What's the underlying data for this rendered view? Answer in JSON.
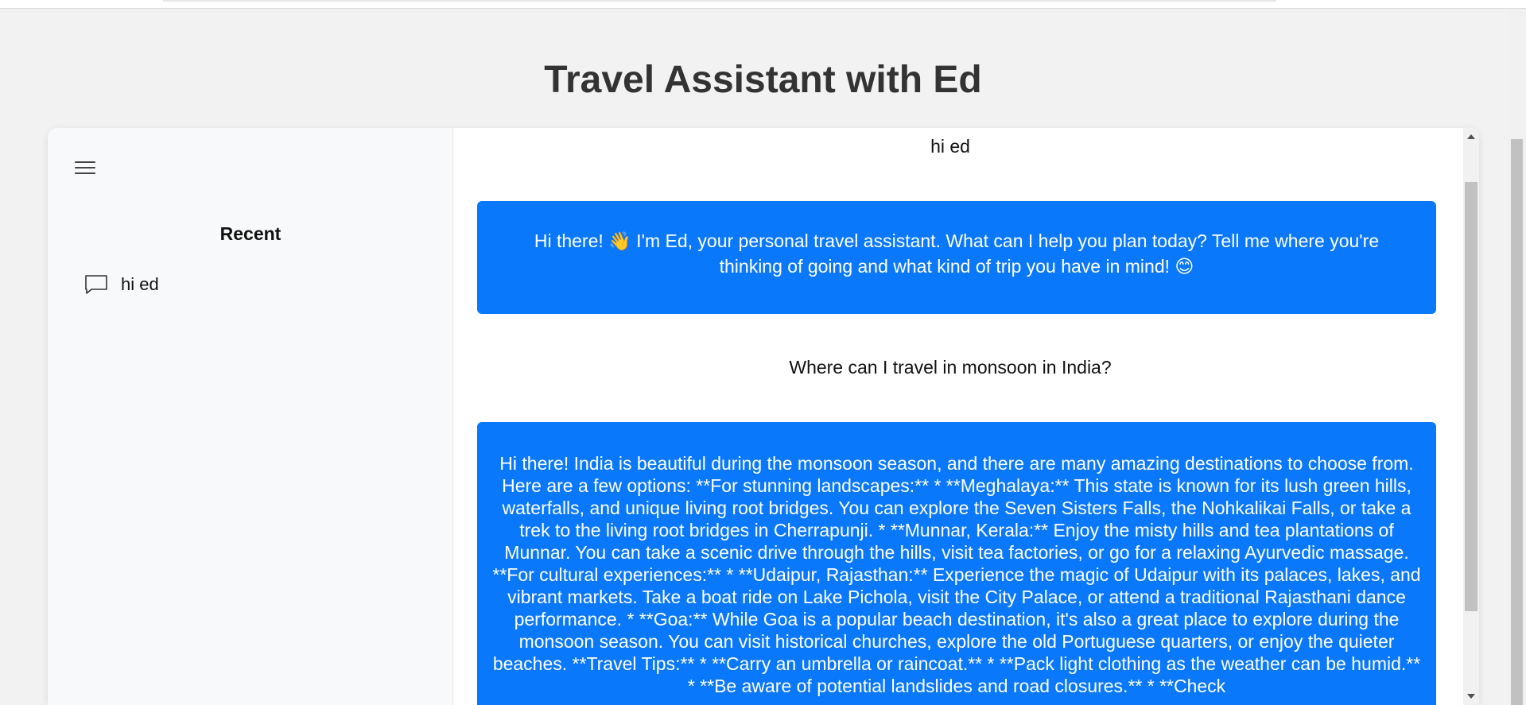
{
  "header": {
    "title": "Travel Assistant with Ed"
  },
  "sidebar": {
    "menu_icon": "hamburger-menu-icon",
    "recent_heading": "Recent",
    "recent_items": [
      {
        "icon": "chat-bubble-icon",
        "label": "hi ed"
      }
    ]
  },
  "chat": {
    "messages": [
      {
        "role": "user",
        "text": "hi ed"
      },
      {
        "role": "assistant",
        "text": "Hi there! 👋 I'm Ed, your personal travel assistant. What can I help you plan today? Tell me where you're thinking of going and what kind of trip you have in mind! 😊"
      },
      {
        "role": "user",
        "text": "Where can I travel in monsoon in India?"
      },
      {
        "role": "assistant",
        "text": "Hi there! India is beautiful during the monsoon season, and there are many amazing destinations to choose from. Here are a few options: **For stunning landscapes:** * **Meghalaya:** This state is known for its lush green hills, waterfalls, and unique living root bridges. You can explore the Seven Sisters Falls, the Nohkalikai Falls, or take a trek to the living root bridges in Cherrapunji. * **Munnar, Kerala:** Enjoy the misty hills and tea plantations of Munnar. You can take a scenic drive through the hills, visit tea factories, or go for a relaxing Ayurvedic massage. **For cultural experiences:** * **Udaipur, Rajasthan:** Experience the magic of Udaipur with its palaces, lakes, and vibrant markets. Take a boat ride on Lake Pichola, visit the City Palace, or attend a traditional Rajasthani dance performance. * **Goa:** While Goa is a popular beach destination, it's also a great place to explore during the monsoon season. You can visit historical churches, explore the old Portuguese quarters, or enjoy the quieter beaches. **Travel Tips:** * **Carry an umbrella or raincoat.** * **Pack light clothing as the weather can be humid.** * **Be aware of potential landslides and road closures.** * **Check"
      }
    ]
  },
  "colors": {
    "accent": "#0a78fa",
    "sidebar_bg": "#f8f9fa",
    "page_bg": "#f2f2f2"
  }
}
